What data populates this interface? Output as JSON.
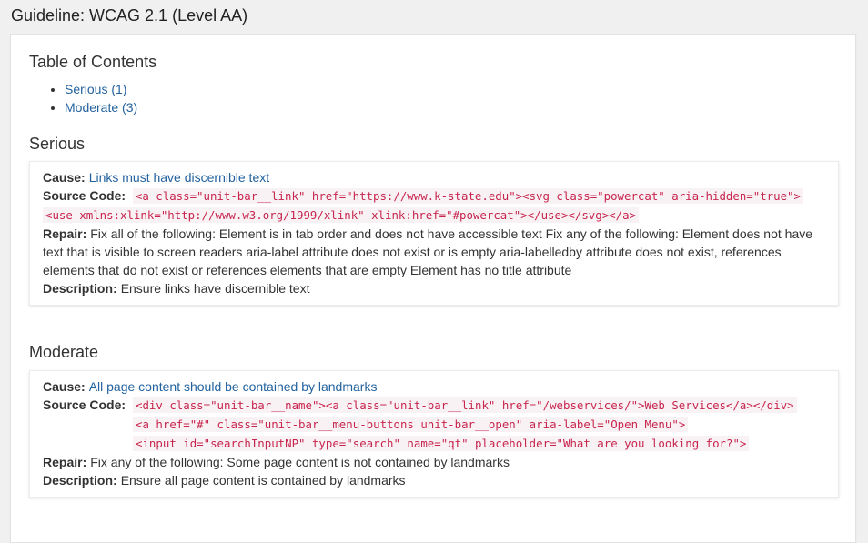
{
  "page": {
    "title": "Guideline: WCAG 2.1 (Level AA)"
  },
  "toc": {
    "title": "Table of Contents",
    "items": [
      {
        "label": "Serious (1)"
      },
      {
        "label": "Moderate (3)"
      }
    ]
  },
  "labels": {
    "cause": "Cause:",
    "source_code": "Source Code:",
    "repair": "Repair:",
    "description": "Description:"
  },
  "sections": [
    {
      "title": "Serious",
      "issues": [
        {
          "cause": "Links must have discernible text",
          "source_code_lines": [
            "<a class=\"unit-bar__link\" href=\"https://www.k-state.edu\"><svg class=\"powercat\" aria-hidden=\"true\">",
            "<use xmlns:xlink=\"http://www.w3.org/1999/xlink\" xlink:href=\"#powercat\"></use></svg></a>"
          ],
          "repair": "Fix all of the following: Element is in tab order and does not have accessible text Fix any of the following: Element does not have text that is visible to screen readers aria-label attribute does not exist or is empty aria-labelledby attribute does not exist, references elements that do not exist or references elements that are empty Element has no title attribute",
          "description": "Ensure links have discernible text"
        }
      ]
    },
    {
      "title": "Moderate",
      "issues": [
        {
          "cause": "All page content should be contained by landmarks",
          "source_code_lines": [
            "<div class=\"unit-bar__name\"><a class=\"unit-bar__link\" href=\"/webservices/\">Web Services</a></div>",
            "<a href=\"#\" class=\"unit-bar__menu-buttons unit-bar__open\" aria-label=\"Open Menu\">",
            "<input id=\"searchInputNP\" type=\"search\" name=\"qt\" placeholder=\"What are you looking for?\">"
          ],
          "repair": "Fix any of the following: Some page content is not contained by landmarks",
          "description": "Ensure all page content is contained by landmarks"
        }
      ]
    }
  ],
  "colors": {
    "link": "#23629e",
    "code_text": "#c7254e",
    "code_bg": "#f9f2f4",
    "page_bg": "#f0f0f0"
  }
}
